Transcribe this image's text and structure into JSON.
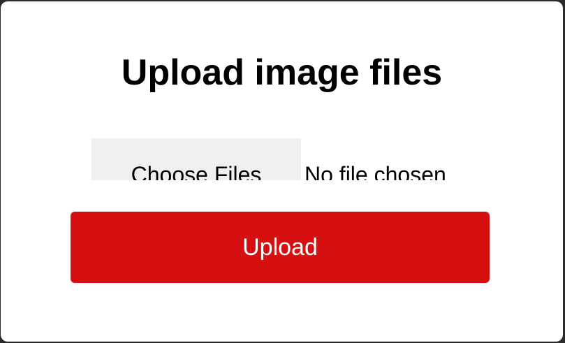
{
  "page": {
    "title": "Upload image files"
  },
  "file_input": {
    "choose_label": "Choose Files",
    "status_text": "No file chosen"
  },
  "upload": {
    "label": "Upload",
    "color": "#d61010"
  }
}
